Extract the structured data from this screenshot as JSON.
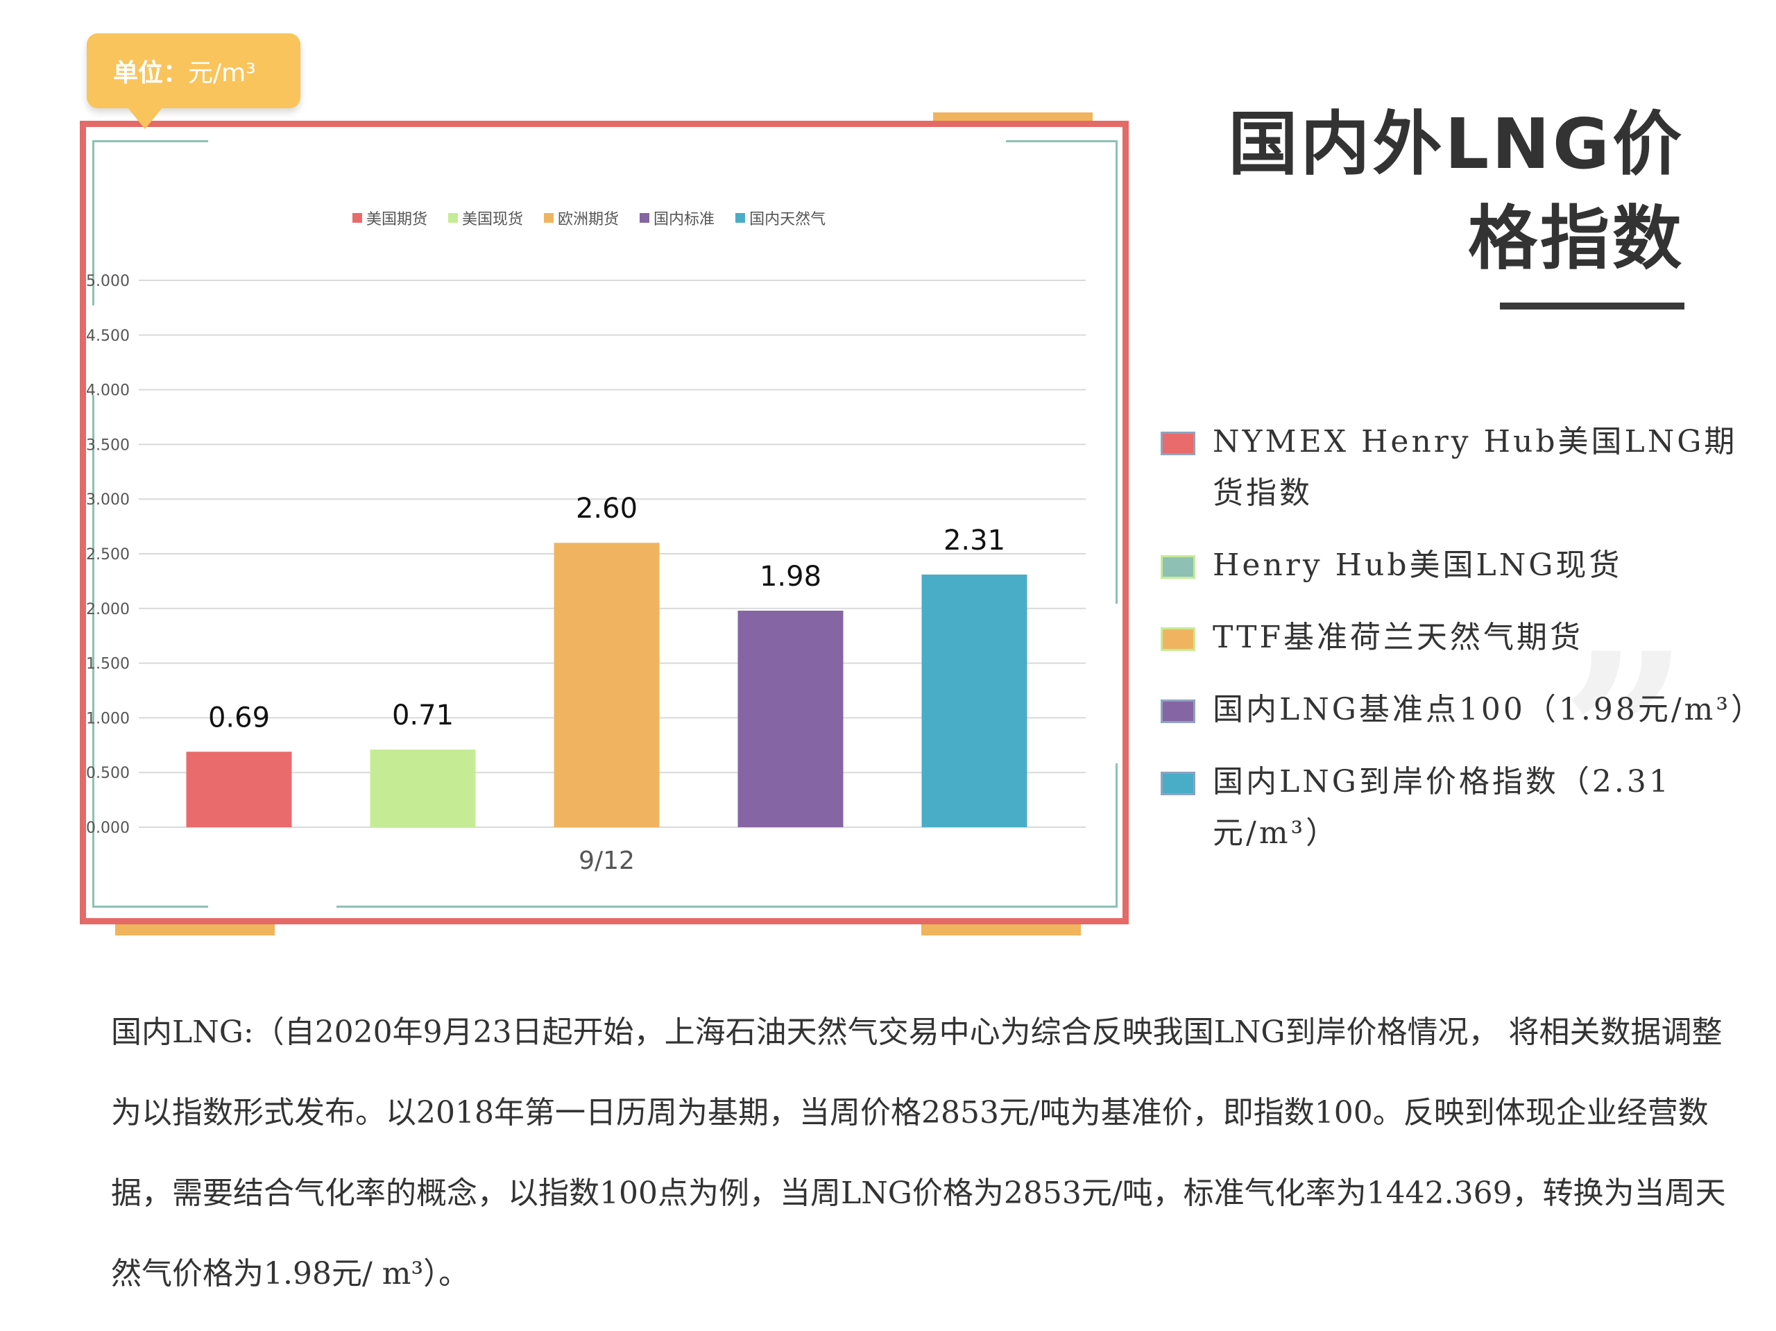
{
  "unit_tag": {
    "label": "单位：",
    "unit": "元/m³"
  },
  "title": {
    "line1": "国内外LNG价",
    "line2": "格指数"
  },
  "chart_data": {
    "type": "bar",
    "categories": [
      "9/12"
    ],
    "series": [
      {
        "name": "美国期货",
        "values": [
          0.69
        ],
        "color": "#e96b6b"
      },
      {
        "name": "美国现货",
        "values": [
          0.71
        ],
        "color": "#c5ec94"
      },
      {
        "name": "欧洲期货",
        "values": [
          2.6
        ],
        "color": "#f0b460"
      },
      {
        "name": "国内标准",
        "values": [
          1.98
        ],
        "color": "#8565a3"
      },
      {
        "name": "国内天然气",
        "values": [
          2.31
        ],
        "color": "#4aadc8"
      }
    ],
    "data_labels": [
      "0.69",
      "0.71",
      "2.60",
      "1.98",
      "2.31"
    ],
    "yticks": [
      "0.000",
      "0.500",
      "1.000",
      "1.500",
      "2.000",
      "2.500",
      "3.000",
      "3.500",
      "4.000",
      "4.500",
      "5.000"
    ],
    "ylim": [
      0,
      5
    ],
    "grid": true,
    "legend_position": "top"
  },
  "legend_right": [
    {
      "text": "NYMEX Henry Hub美国LNG期货指数",
      "color": "#e96b6b"
    },
    {
      "text": "Henry Hub美国LNG现货",
      "color": "#8fc0b4"
    },
    {
      "text": "TTF基准荷兰天然气期货",
      "color": "#f0b460"
    },
    {
      "text": "国内LNG基准点100（1.98元/m³）",
      "color": "#8565a3"
    },
    {
      "text": "国内LNG到岸价格指数（2.31元/m³）",
      "color": "#4aadc8"
    }
  ],
  "paragraph": "国内LNG:（自2020年9月23日起开始，上海石油天然气交易中心为综合反映我国LNG到岸价格情况， 将相关数据调整为以指数形式发布。以2018年第一日历周为基期，当周价格2853元/吨为基准价，即指数100。反映到体现企业经营数据，需要结合气化率的概念，以指数100点为例，当周LNG价格为2853元/吨，标准气化率为1442.369，转换为当周天然气价格为1.98元/ m³）。"
}
